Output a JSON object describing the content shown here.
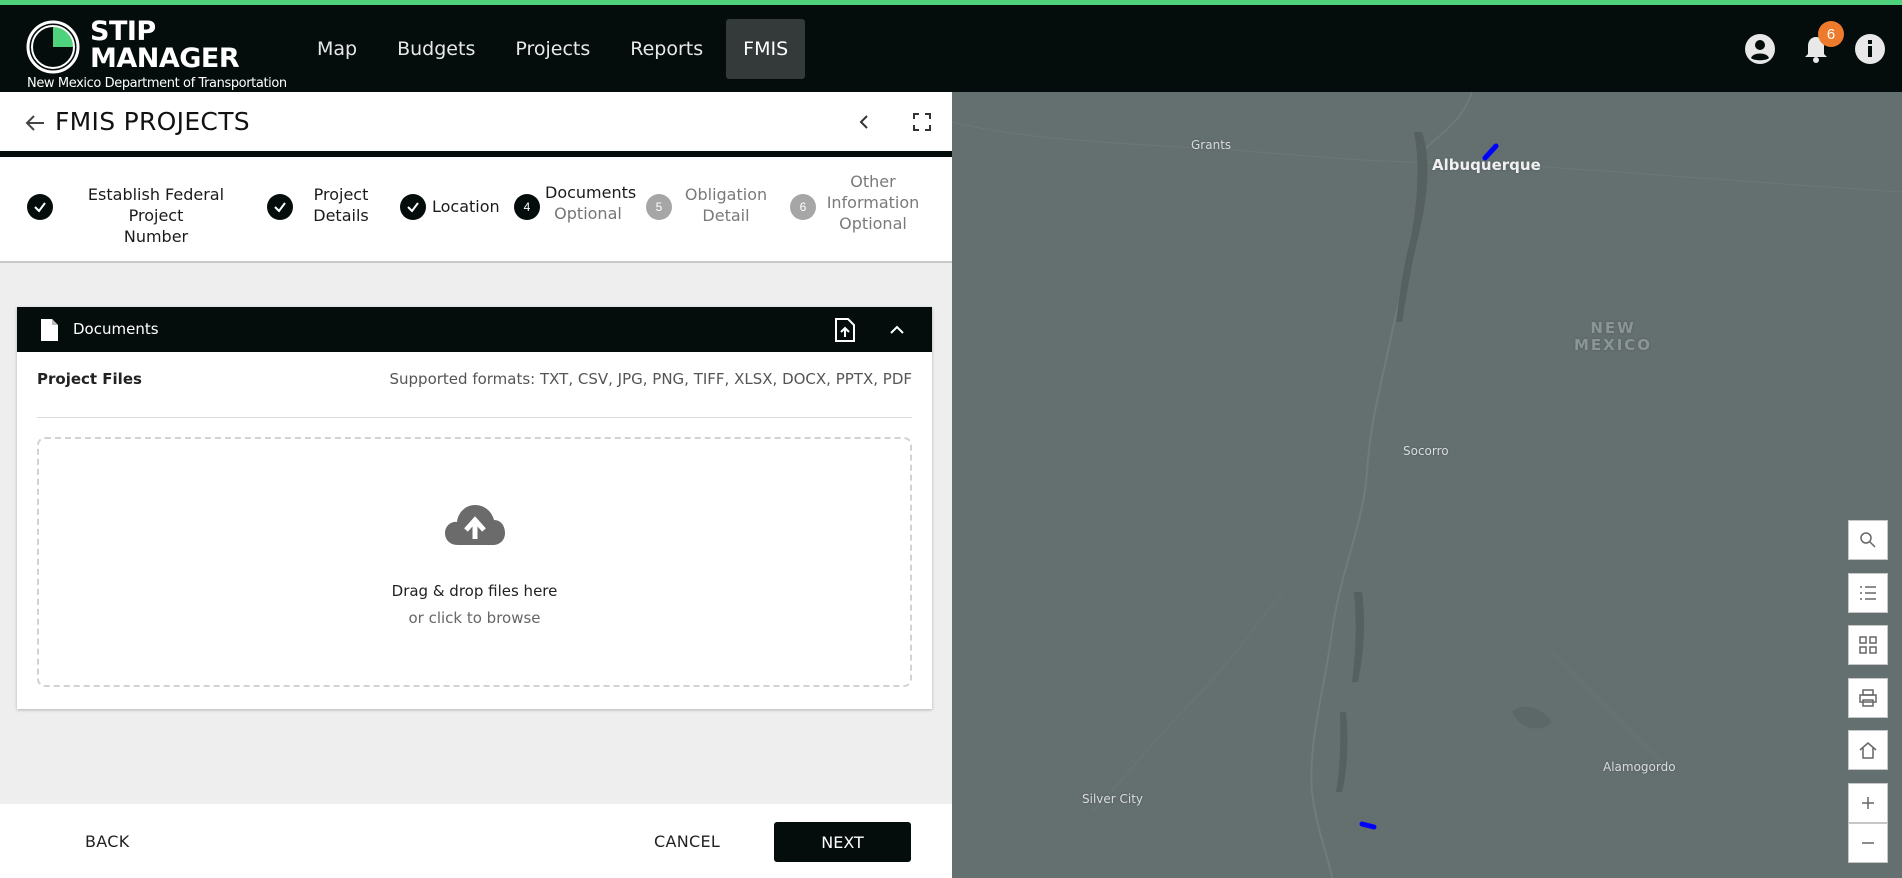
{
  "app": {
    "title_line1": "STIP",
    "title_line2": "MANAGER",
    "subtitle": "New Mexico Department of Transportation"
  },
  "nav": {
    "items": [
      {
        "label": "Map",
        "active": false
      },
      {
        "label": "Budgets",
        "active": false
      },
      {
        "label": "Projects",
        "active": false
      },
      {
        "label": "Reports",
        "active": false
      },
      {
        "label": "FMIS",
        "active": true
      }
    ],
    "notification_count": "6",
    "icons": [
      "account-circle-icon",
      "bell-icon",
      "info-icon"
    ]
  },
  "panel": {
    "title": "FMIS PROJECTS"
  },
  "steps": [
    {
      "line1": "Establish Federal Project",
      "line2": "Number",
      "line3": "",
      "marker": "",
      "state": "done"
    },
    {
      "line1": "Project",
      "line2": "Details",
      "line3": "",
      "marker": "",
      "state": "done"
    },
    {
      "line1": "Location",
      "line2": "",
      "line3": "",
      "marker": "",
      "state": "done"
    },
    {
      "line1": "Documents",
      "line2": "Optional",
      "line3": "",
      "marker": "4",
      "state": "current"
    },
    {
      "line1": "Obligation",
      "line2": "Detail",
      "line3": "",
      "marker": "5",
      "state": "future"
    },
    {
      "line1": "Other",
      "line2": "Information",
      "line3": "Optional",
      "marker": "6",
      "state": "future"
    }
  ],
  "documents": {
    "title": "Documents",
    "files_label": "Project Files",
    "formats": "Supported formats: TXT, CSV, JPG, PNG, TIFF, XLSX, DOCX, PPTX, PDF",
    "drop_text": "Drag & drop files here",
    "drop_sub": "or click to browse"
  },
  "footer": {
    "back": "BACK",
    "cancel": "CANCEL",
    "next": "NEXT"
  },
  "map": {
    "labels": {
      "grants": "Grants",
      "albuquerque": "Albuquerque",
      "state_line1": "NEW",
      "state_line2": "MEXICO",
      "socorro": "Socorro",
      "alamogordo": "Alamogordo",
      "silver_city": "Silver City"
    },
    "tools": [
      "search-icon",
      "list-icon",
      "qr-code-icon",
      "print-icon",
      "home-icon",
      "zoom-in-icon",
      "zoom-out-icon"
    ],
    "colors": {
      "background": "#646f70",
      "highlight": "#0000ff"
    }
  },
  "colors": {
    "accent": "#4fd27c",
    "nav_bg": "#040d0b",
    "badge": "#ee7a2c"
  }
}
